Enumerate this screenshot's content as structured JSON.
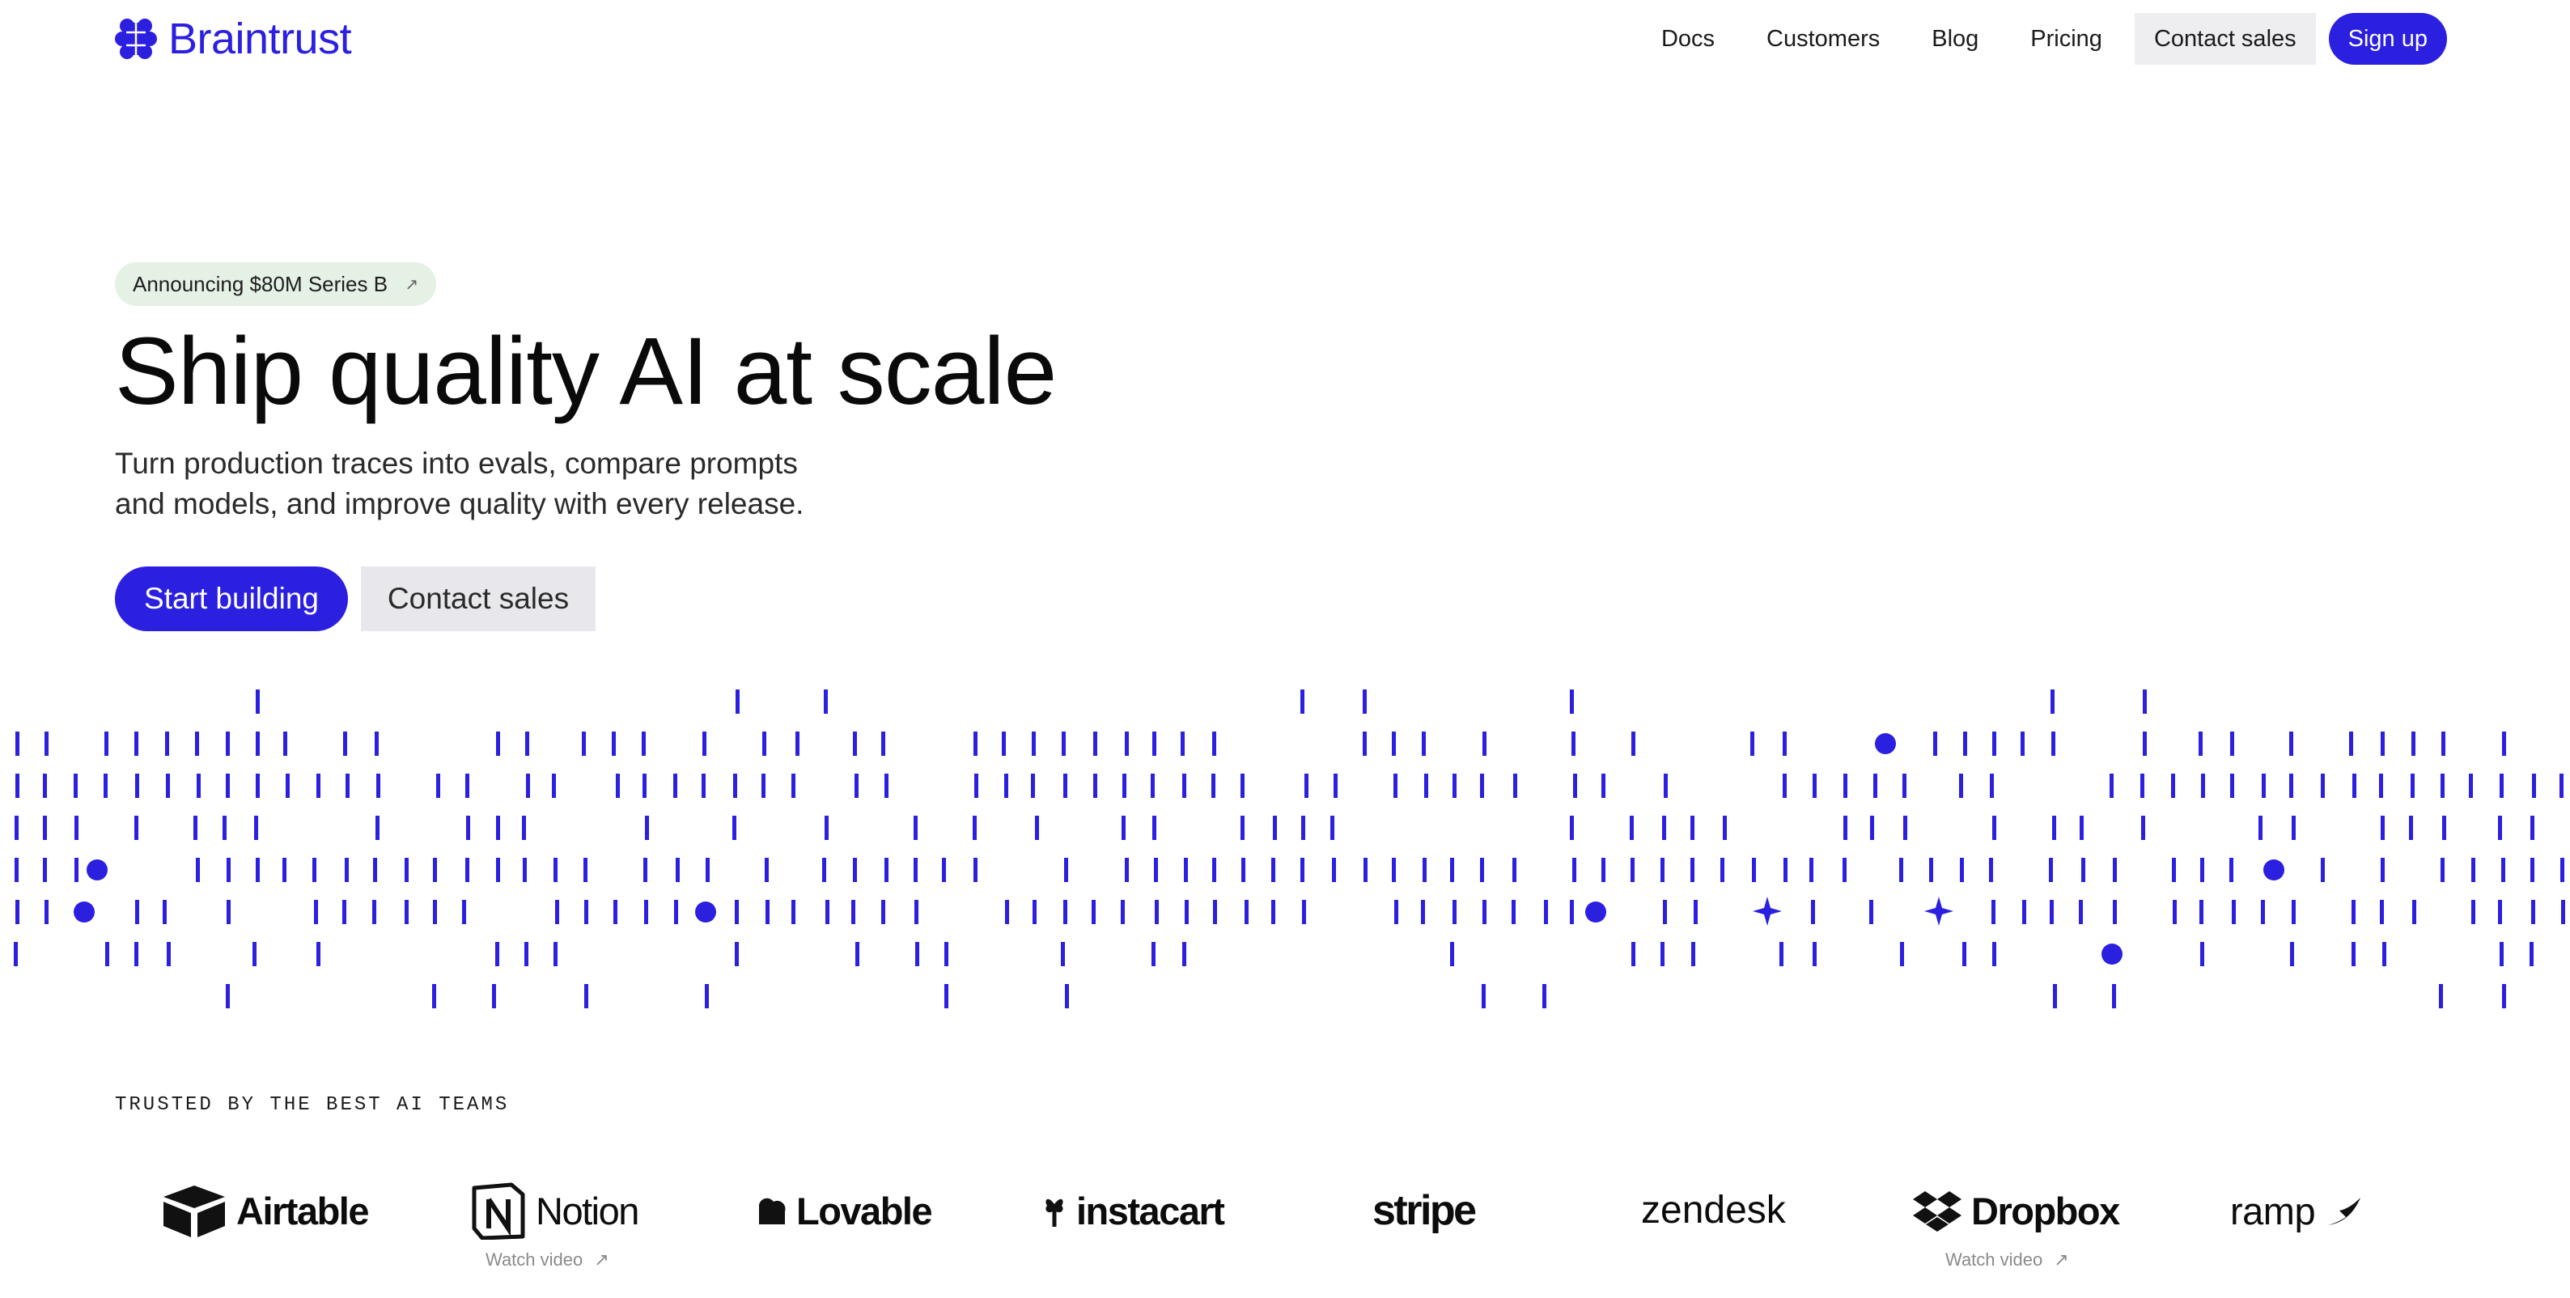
{
  "brand": {
    "name": "Braintrust",
    "color": "#2b1fe0"
  },
  "nav": {
    "links": [
      "Docs",
      "Customers",
      "Blog",
      "Pricing"
    ],
    "contact_label": "Contact sales",
    "signup_label": "Sign up"
  },
  "announcement": {
    "label": "Announcing $80M Series B",
    "icon": "arrow-up-right-icon"
  },
  "hero": {
    "title": "Ship quality AI at scale",
    "subtitle_line1": "Turn production traces into evals, compare prompts",
    "subtitle_line2": "and models, and improve quality with every release.",
    "primary_cta": "Start building",
    "secondary_cta": "Contact sales"
  },
  "trusted": {
    "heading": "TRUSTED BY THE BEST AI TEAMS",
    "logos": [
      {
        "name": "Airtable",
        "icon": "airtable-logo-icon"
      },
      {
        "name": "Notion",
        "icon": "notion-logo-icon",
        "link": "Watch video"
      },
      {
        "name": "Lovable",
        "icon": "lovable-logo-icon"
      },
      {
        "name": "instacart",
        "icon": "instacart-logo-icon"
      },
      {
        "name": "stripe",
        "icon": ""
      },
      {
        "name": "zendesk",
        "icon": ""
      },
      {
        "name": "Dropbox",
        "icon": "dropbox-logo-icon",
        "link": "Watch video"
      },
      {
        "name": "ramp",
        "icon": "ramp-logo-icon"
      }
    ]
  }
}
